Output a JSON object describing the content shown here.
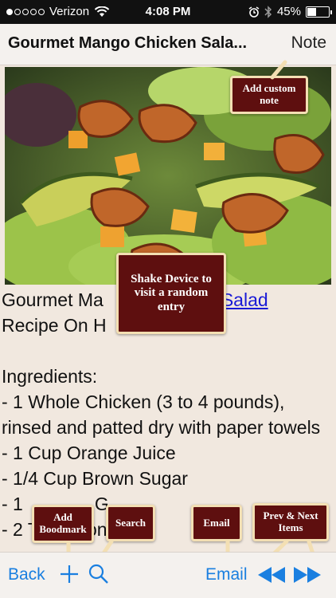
{
  "status_bar": {
    "carrier": "Verizon",
    "time": "4:08 PM",
    "battery_percent": "45%",
    "battery_level": 0.45,
    "signal_dots_filled": 1,
    "signal_dots_total": 5
  },
  "nav": {
    "title": "Gourmet Mango Chicken Sala...",
    "note_button": "Note"
  },
  "photo": {
    "icon": "salad-photo"
  },
  "recipe": {
    "title_part1": "Gourmet Ma",
    "title_link": "Salad",
    "title_line2": "Recipe On H",
    "ingredients_heading": "Ingredients:",
    "items": [
      "- 1 Whole Chicken (3 to 4 pounds), rinsed and patted dry with paper towels",
      "- 1 Cup Orange Juice",
      "- 1/4 Cup Brown Sugar",
      "- 1",
      "- 2 Teaspoons Salt"
    ],
    "item4_fragment": "G"
  },
  "callouts": {
    "custom_note": "Add custom note",
    "shake": "Shake Device to visit a random entry",
    "bookmark": "Add Boodmark",
    "search": "Search",
    "email": "Email",
    "prev_next": "Prev & Next Items"
  },
  "toolbar": {
    "back": "Back",
    "email": "Email"
  },
  "colors": {
    "accent": "#1a7fe0",
    "callout_bg": "#5e0f0f",
    "callout_border": "#f3dfb3",
    "background": "#f1e8df"
  }
}
